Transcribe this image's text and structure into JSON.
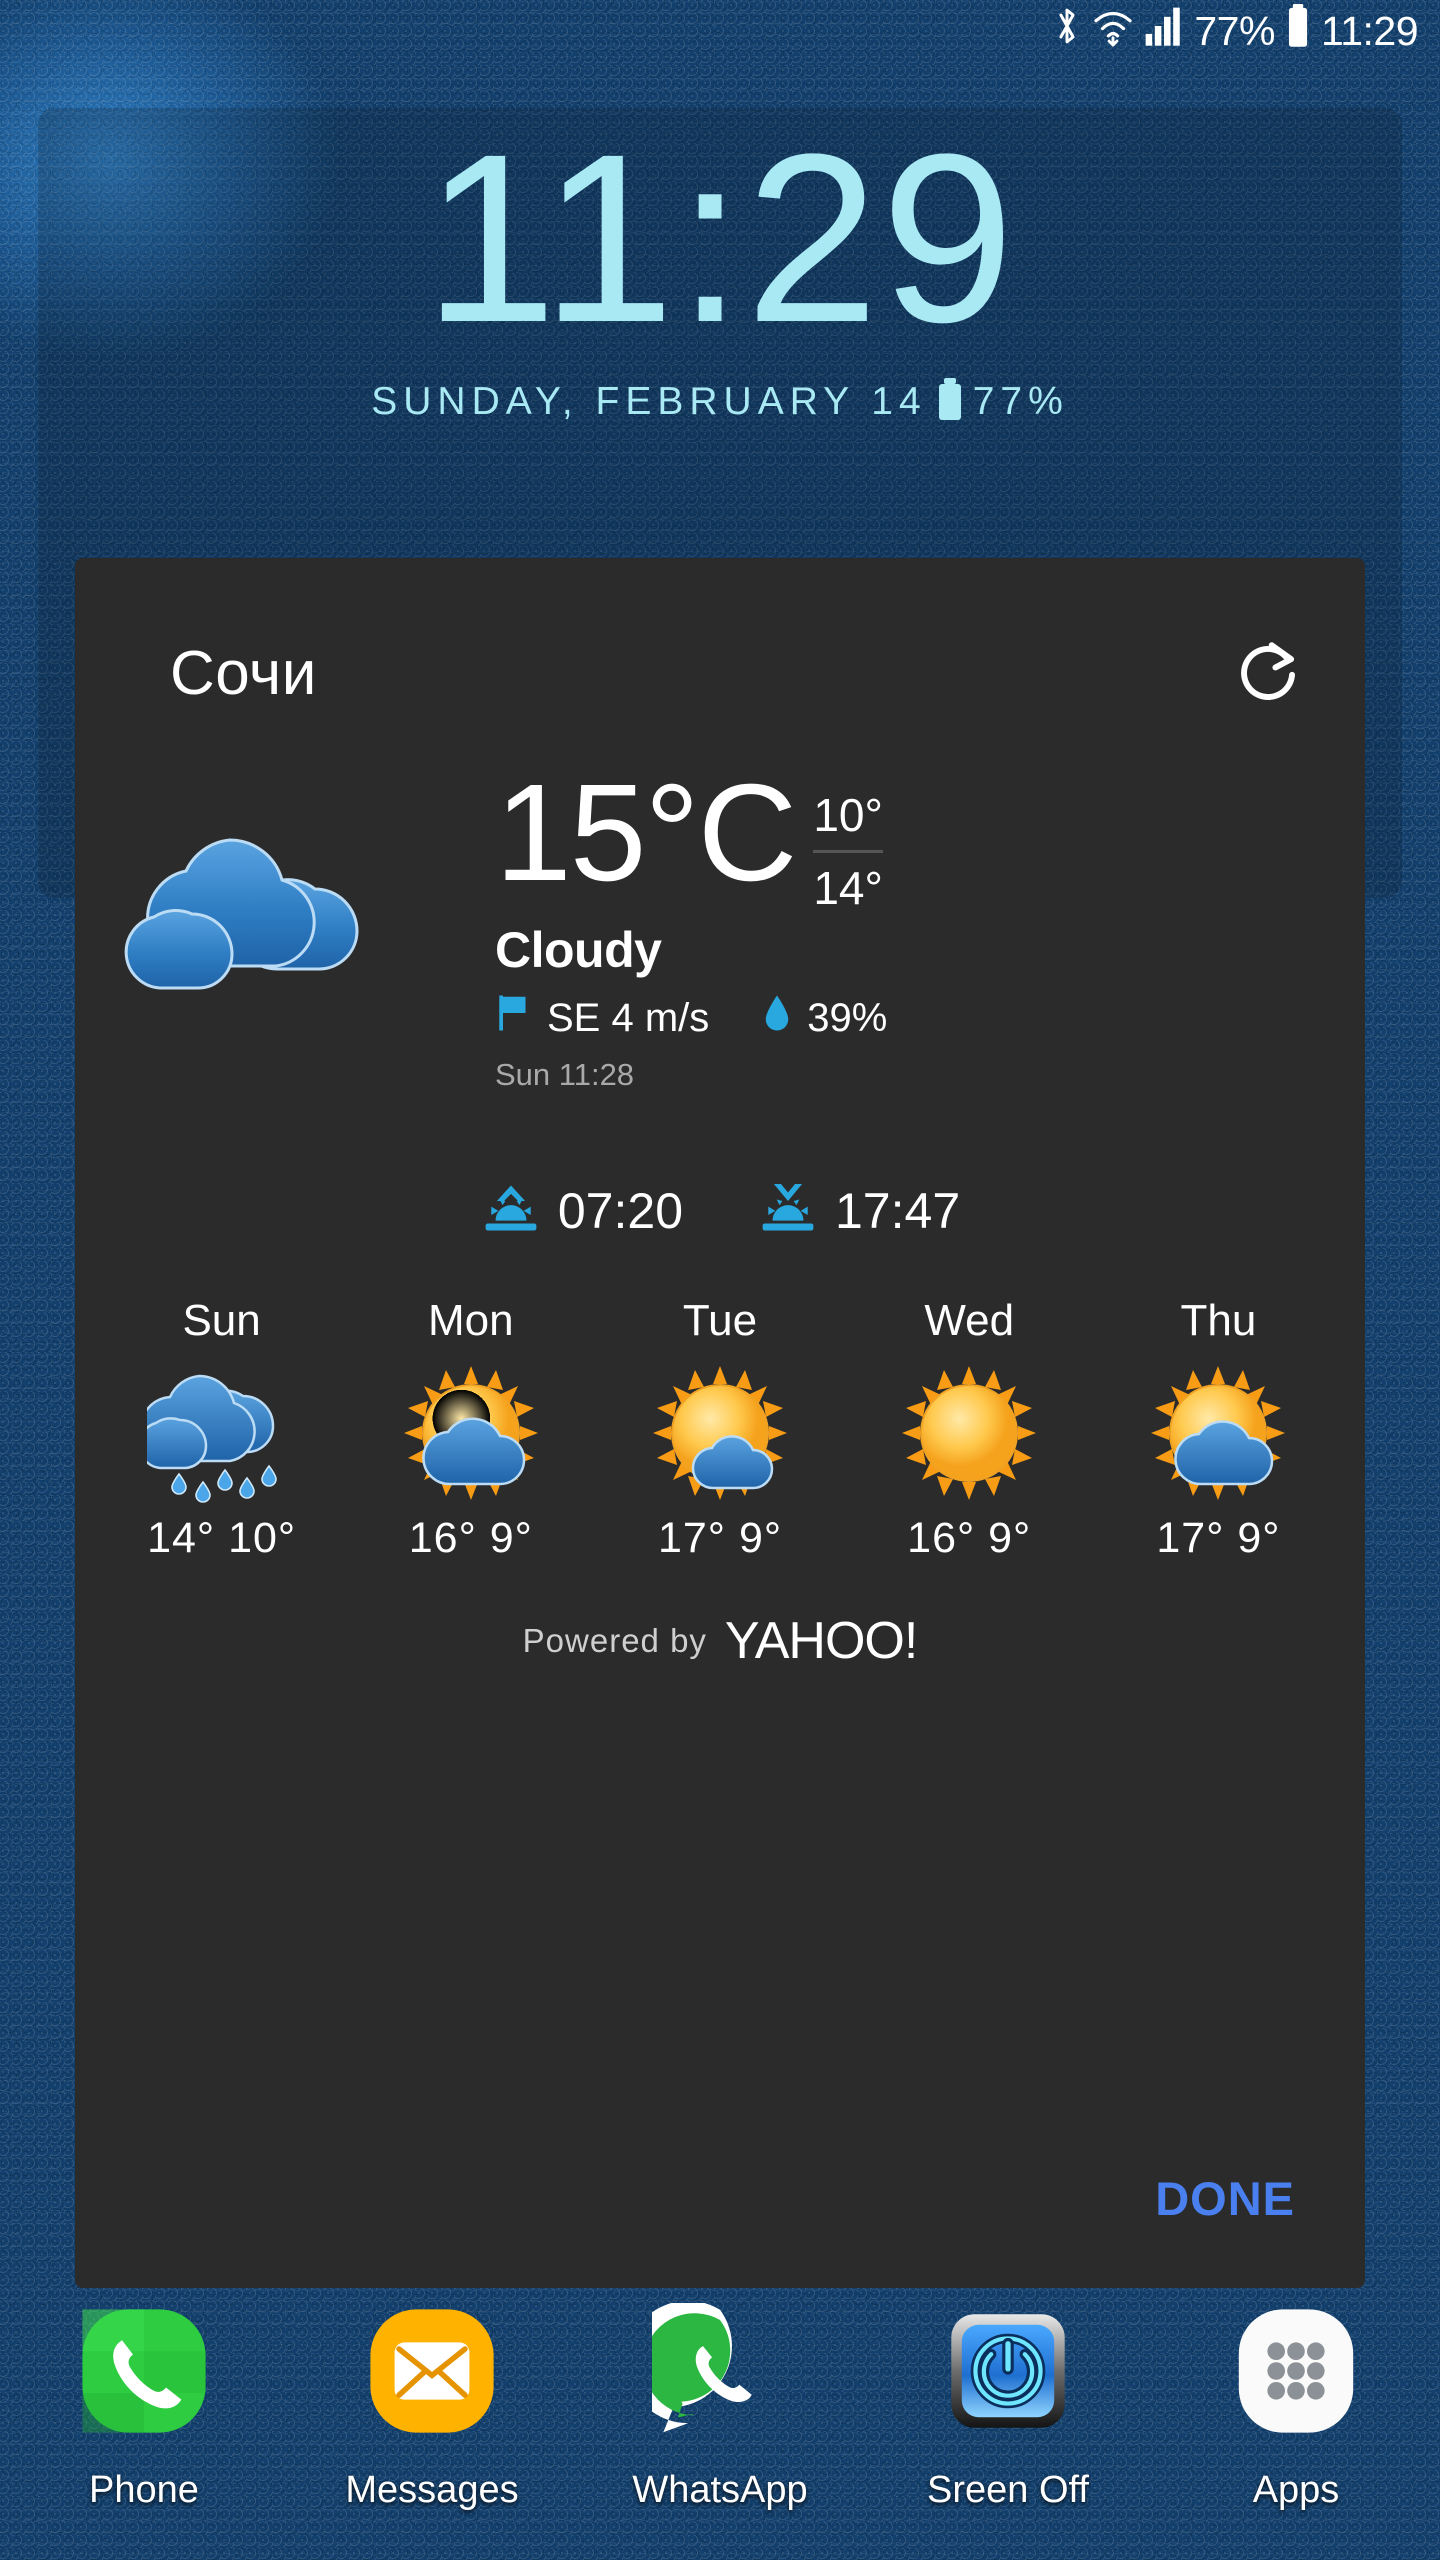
{
  "status_bar": {
    "battery_percent": "77%",
    "time": "11:29",
    "icons": [
      "bluetooth-icon",
      "wifi-icon",
      "signal-icon",
      "battery-icon"
    ]
  },
  "clock_widget": {
    "time": "11:29",
    "date": "SUNDAY, FEBRUARY 14",
    "battery_percent": "77%",
    "accent_color": "#a8e9f4"
  },
  "weather_panel": {
    "city": "Сочи",
    "refresh_icon": "refresh-icon",
    "current": {
      "icon": "cloudy-icon",
      "temperature": "15°C",
      "high": "10°",
      "low": "14°",
      "condition": "Cloudy",
      "wind_icon": "flag-icon",
      "wind": "SE 4 m/s",
      "humidity_icon": "droplet-icon",
      "humidity": "39%",
      "updated": "Sun 11:28"
    },
    "sun": {
      "sunrise_icon": "sunrise-icon",
      "sunrise": "07:20",
      "sunset_icon": "sunset-icon",
      "sunset": "17:47"
    },
    "forecast": [
      {
        "day": "Sun",
        "icon": "rain-icon",
        "high": "14°",
        "low": "10°"
      },
      {
        "day": "Mon",
        "icon": "sun-cloud-icon",
        "high": "16°",
        "low": "9°"
      },
      {
        "day": "Tue",
        "icon": "sun-sm-cloud-icon",
        "high": "17°",
        "low": "9°"
      },
      {
        "day": "Wed",
        "icon": "sun-icon",
        "high": "16°",
        "low": "9°"
      },
      {
        "day": "Thu",
        "icon": "sun-cloud-icon",
        "high": "17°",
        "low": "9°"
      }
    ],
    "powered_by_label": "Powered by",
    "powered_by_brand": "YAHOO!",
    "done_label": "DONE",
    "done_color": "#4a7ff0",
    "background_color": "#2b2b2b"
  },
  "dock": [
    {
      "label": "Phone",
      "icon": "phone-icon"
    },
    {
      "label": "Messages",
      "icon": "messages-icon"
    },
    {
      "label": "WhatsApp",
      "icon": "whatsapp-icon"
    },
    {
      "label": "Sreen Off",
      "icon": "power-icon"
    },
    {
      "label": "Apps",
      "icon": "apps-grid-icon"
    }
  ]
}
